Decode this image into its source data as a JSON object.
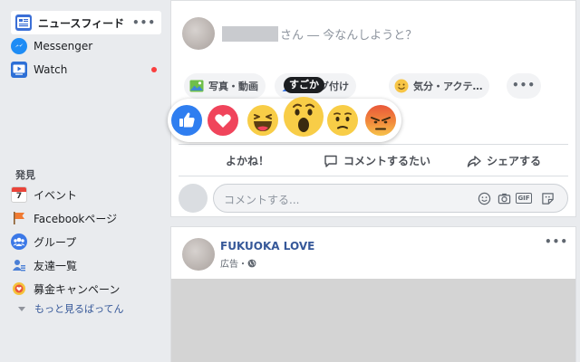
{
  "sidebar": {
    "items": [
      {
        "label": "ニュースフィード",
        "icon": "news-feed-icon",
        "more": "•••"
      },
      {
        "label": "Messenger",
        "icon": "messenger-icon"
      },
      {
        "label": "Watch",
        "icon": "watch-icon"
      }
    ],
    "explore_label": "発見",
    "explore": [
      {
        "label": "イベント",
        "icon": "calendar-icon",
        "icon_text": "7"
      },
      {
        "label": "Facebookページ",
        "icon": "flag-icon"
      },
      {
        "label": "グループ",
        "icon": "groups-icon"
      },
      {
        "label": "友達一覧",
        "icon": "friends-list-icon"
      },
      {
        "label": "募金キャンペーン",
        "icon": "fundraiser-icon"
      }
    ],
    "see_more": "もっと見るばってん"
  },
  "composer": {
    "prompt_suffix": "さん ― 今なんしようと？",
    "chips": [
      {
        "label": "写真・動画",
        "icon": "photo-icon"
      },
      {
        "label": "をタグ付け",
        "icon": "tag-friends-icon"
      },
      {
        "label": "気分・アクテ…",
        "icon": "feeling-icon"
      }
    ],
    "chip_more": "•••"
  },
  "reactions": {
    "tooltip": "すごか",
    "items": [
      "like",
      "love",
      "haha",
      "wow",
      "sad",
      "angry"
    ]
  },
  "post_actions": {
    "like": "よかね！",
    "comment": "コメントするたい",
    "share": "シェアする"
  },
  "comment_box": {
    "placeholder": "コメントする...",
    "gif_label": "GIF"
  },
  "ad_post": {
    "page_name": "FUKUOKA LOVE",
    "sponsored": "広告・",
    "more": "•••"
  },
  "colors": {
    "brand_blue": "#365899",
    "like_blue": "#2f7ef0",
    "love_red": "#f0445b",
    "notification_red": "#fa3e3e"
  }
}
